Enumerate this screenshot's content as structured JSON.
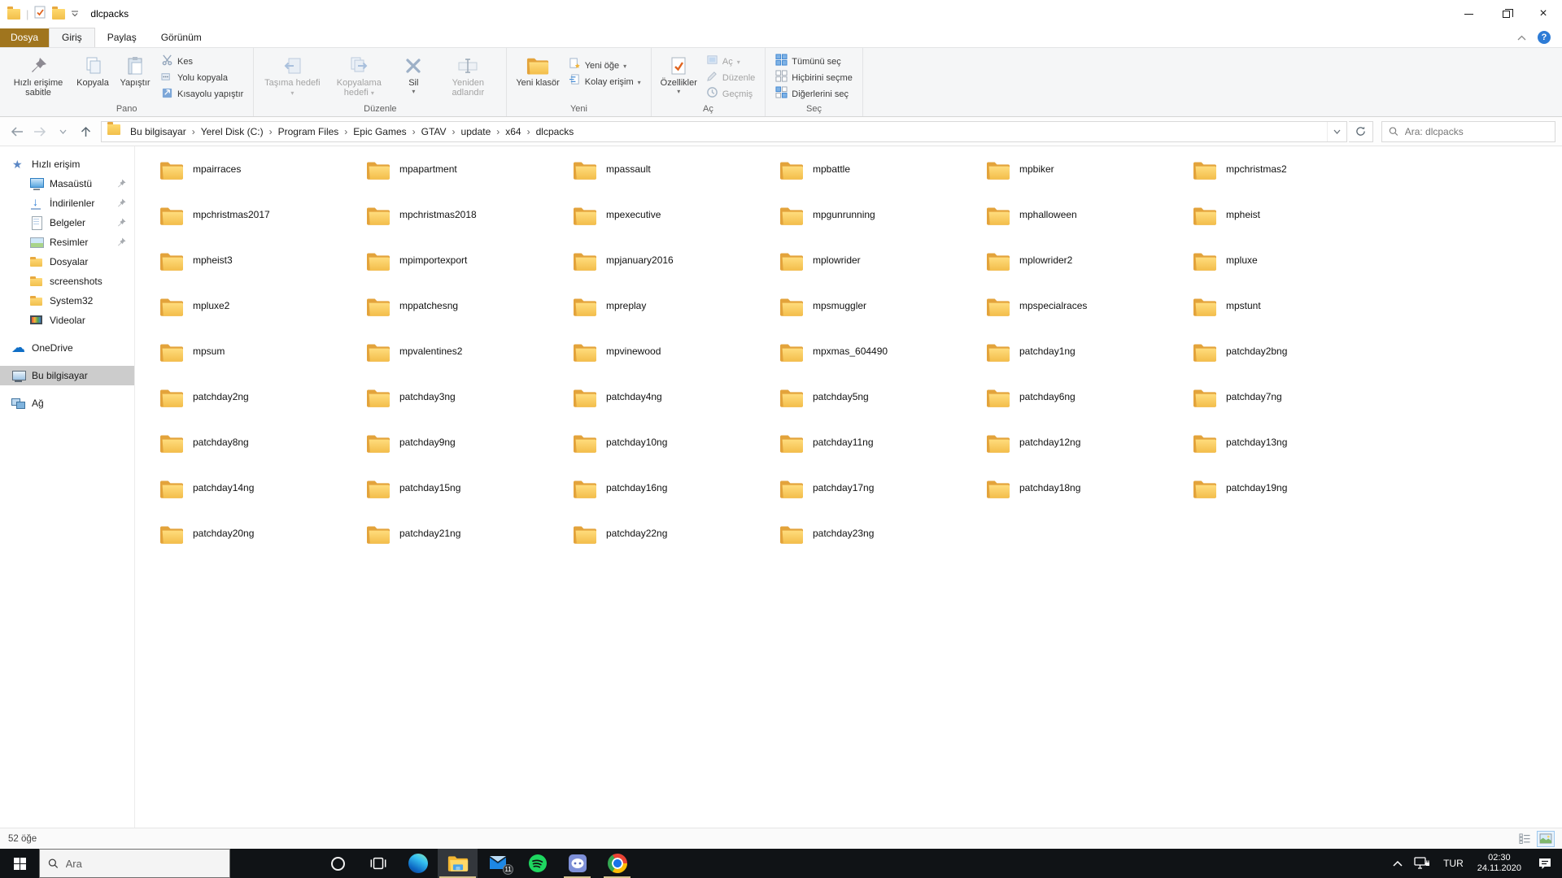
{
  "titlebar": {
    "title": "dlcpacks"
  },
  "tabs": {
    "file": "Dosya",
    "items": [
      {
        "label": "Giriş",
        "active": true
      },
      {
        "label": "Paylaş"
      },
      {
        "label": "Görünüm"
      }
    ]
  },
  "ribbon": {
    "pin_quick": "Hızlı erişime sabitle",
    "copy": "Kopyala",
    "paste": "Yapıştır",
    "cut": "Kes",
    "copy_path": "Yolu kopyala",
    "paste_shortcut": "Kısayolu yapıştır",
    "move_to": "Taşıma hedefi",
    "copy_to": "Kopyalama hedefi",
    "delete": "Sil",
    "rename": "Yeniden adlandır",
    "new_folder": "Yeni klasör",
    "new_item": "Yeni öğe",
    "easy_access": "Kolay erişim",
    "properties": "Özellikler",
    "open": "Aç",
    "edit": "Düzenle",
    "history": "Geçmiş",
    "select_all": "Tümünü seç",
    "select_none": "Hiçbirini seçme",
    "invert_selection": "Diğerlerini seç",
    "groups": {
      "clipboard": "Pano",
      "organize": "Düzenle",
      "new": "Yeni",
      "open": "Aç",
      "select": "Seç"
    }
  },
  "addressbar": {
    "breadcrumb": [
      "Bu bilgisayar",
      "Yerel Disk (C:)",
      "Program Files",
      "Epic Games",
      "GTAV",
      "update",
      "x64",
      "dlcpacks"
    ],
    "search_placeholder": "Ara: dlcpacks"
  },
  "sidebar": {
    "items": [
      {
        "id": "quick-access",
        "label": "Hızlı erişim",
        "icon": "star",
        "level": 0
      },
      {
        "id": "desktop",
        "label": "Masaüstü",
        "icon": "desktop",
        "level": 1,
        "pinned": true
      },
      {
        "id": "downloads",
        "label": "İndirilenler",
        "icon": "downloads",
        "level": 1,
        "pinned": true
      },
      {
        "id": "documents",
        "label": "Belgeler",
        "icon": "document",
        "level": 1,
        "pinned": true
      },
      {
        "id": "pictures",
        "label": "Resimler",
        "icon": "pictures",
        "level": 1,
        "pinned": true
      },
      {
        "id": "dosyalar",
        "label": "Dosyalar",
        "icon": "folder",
        "level": 1
      },
      {
        "id": "screenshots",
        "label": "screenshots",
        "icon": "folder",
        "level": 1
      },
      {
        "id": "system32",
        "label": "System32",
        "icon": "folder",
        "level": 1
      },
      {
        "id": "videos",
        "label": "Videolar",
        "icon": "videos",
        "level": 1
      },
      {
        "id": "onedrive",
        "label": "OneDrive",
        "icon": "onedrive",
        "level": 0,
        "section": true
      },
      {
        "id": "this-pc",
        "label": "Bu bilgisayar",
        "icon": "computer",
        "level": 0,
        "section": true,
        "selected": true
      },
      {
        "id": "network",
        "label": "Ağ",
        "icon": "network",
        "level": 0,
        "section": true
      }
    ]
  },
  "folders": [
    "mpairraces",
    "mpapartment",
    "mpassault",
    "mpbattle",
    "mpbiker",
    "mpchristmas2",
    "mpchristmas2017",
    "mpchristmas2018",
    "mpexecutive",
    "mpgunrunning",
    "mphalloween",
    "mpheist",
    "mpheist3",
    "mpimportexport",
    "mpjanuary2016",
    "mplowrider",
    "mplowrider2",
    "mpluxe",
    "mpluxe2",
    "mppatchesng",
    "mpreplay",
    "mpsmuggler",
    "mpspecialraces",
    "mpstunt",
    "mpsum",
    "mpvalentines2",
    "mpvinewood",
    "mpxmas_604490",
    "patchday1ng",
    "patchday2bng",
    "patchday2ng",
    "patchday3ng",
    "patchday4ng",
    "patchday5ng",
    "patchday6ng",
    "patchday7ng",
    "patchday8ng",
    "patchday9ng",
    "patchday10ng",
    "patchday11ng",
    "patchday12ng",
    "patchday13ng",
    "patchday14ng",
    "patchday15ng",
    "patchday16ng",
    "patchday17ng",
    "patchday18ng",
    "patchday19ng",
    "patchday20ng",
    "patchday21ng",
    "patchday22ng",
    "patchday23ng"
  ],
  "statusbar": {
    "count": "52 öğe"
  },
  "taskbar": {
    "search_placeholder": "Ara",
    "language": "TUR",
    "time": "02:30",
    "date": "24.11.2020",
    "mail_badge": "11"
  },
  "colors": {
    "accent_folder": "#f3c04b",
    "file_tab": "#a0751e",
    "taskbar": "#101316",
    "run_indicator": "#d6c28d"
  }
}
